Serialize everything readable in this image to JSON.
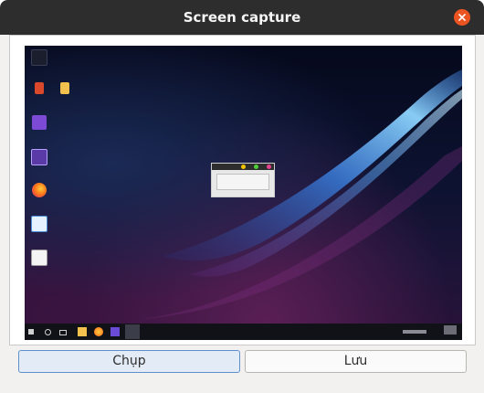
{
  "window": {
    "title": "Screen capture"
  },
  "preview": {
    "desktop_icons": [
      {
        "icon": "this-pc-icon",
        "label": ""
      },
      {
        "icon": "recycle-bin-icon",
        "label": ""
      },
      {
        "icon": "folder-icon",
        "label": ""
      },
      {
        "icon": "monitor-icon",
        "label": ""
      },
      {
        "icon": "app-icon",
        "label": ""
      },
      {
        "icon": "firefox-icon",
        "label": ""
      },
      {
        "icon": "file-icon",
        "label": ""
      },
      {
        "icon": "document-icon",
        "label": ""
      }
    ],
    "mini_window": {
      "label": ""
    },
    "colors": {
      "accent": "#e95420",
      "desktop_glow": "#4aa8ff"
    }
  },
  "buttons": {
    "capture_label": "Chụp",
    "save_label": "Lưu"
  }
}
